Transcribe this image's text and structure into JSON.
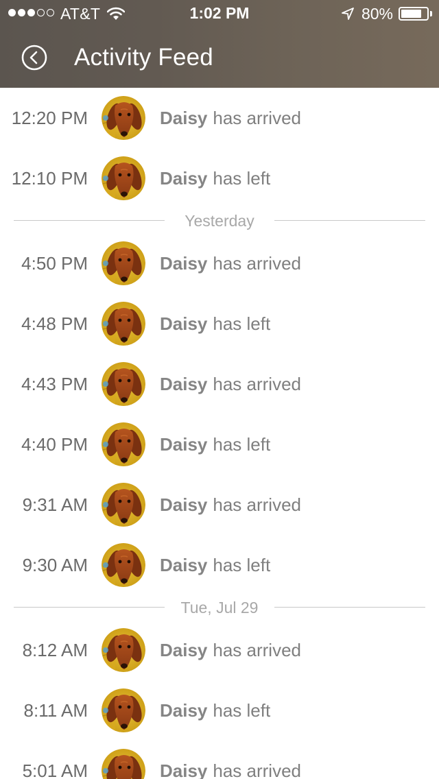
{
  "status_bar": {
    "signal_dots": [
      "full",
      "full",
      "full",
      "empty",
      "empty"
    ],
    "carrier": "AT&T",
    "time": "1:02 PM",
    "battery_percent": "80%",
    "battery_level": 0.8
  },
  "header": {
    "back_icon": "chevron-left-circle-icon",
    "title": "Activity Feed"
  },
  "colors": {
    "header_gradient_start": "#5b554f",
    "header_gradient_end": "#776a5b",
    "text_gray": "#7f7f7f",
    "divider": "#c8c8c8"
  },
  "feed": [
    {
      "kind": "event",
      "time": "12:20 PM",
      "name": "Daisy",
      "action": "has arrived"
    },
    {
      "kind": "event",
      "time": "12:10 PM",
      "name": "Daisy",
      "action": "has left"
    },
    {
      "kind": "divider",
      "label": "Yesterday"
    },
    {
      "kind": "event",
      "time": "4:50 PM",
      "name": "Daisy",
      "action": "has arrived"
    },
    {
      "kind": "event",
      "time": "4:48 PM",
      "name": "Daisy",
      "action": "has left"
    },
    {
      "kind": "event",
      "time": "4:43 PM",
      "name": "Daisy",
      "action": "has arrived"
    },
    {
      "kind": "event",
      "time": "4:40 PM",
      "name": "Daisy",
      "action": "has left"
    },
    {
      "kind": "event",
      "time": "9:31 AM",
      "name": "Daisy",
      "action": "has arrived"
    },
    {
      "kind": "event",
      "time": "9:30 AM",
      "name": "Daisy",
      "action": "has left"
    },
    {
      "kind": "divider",
      "label": "Tue, Jul 29"
    },
    {
      "kind": "event",
      "time": "8:12 AM",
      "name": "Daisy",
      "action": "has arrived"
    },
    {
      "kind": "event",
      "time": "8:11 AM",
      "name": "Daisy",
      "action": "has left"
    },
    {
      "kind": "event",
      "time": "5:01 AM",
      "name": "Daisy",
      "action": "has arrived"
    }
  ]
}
